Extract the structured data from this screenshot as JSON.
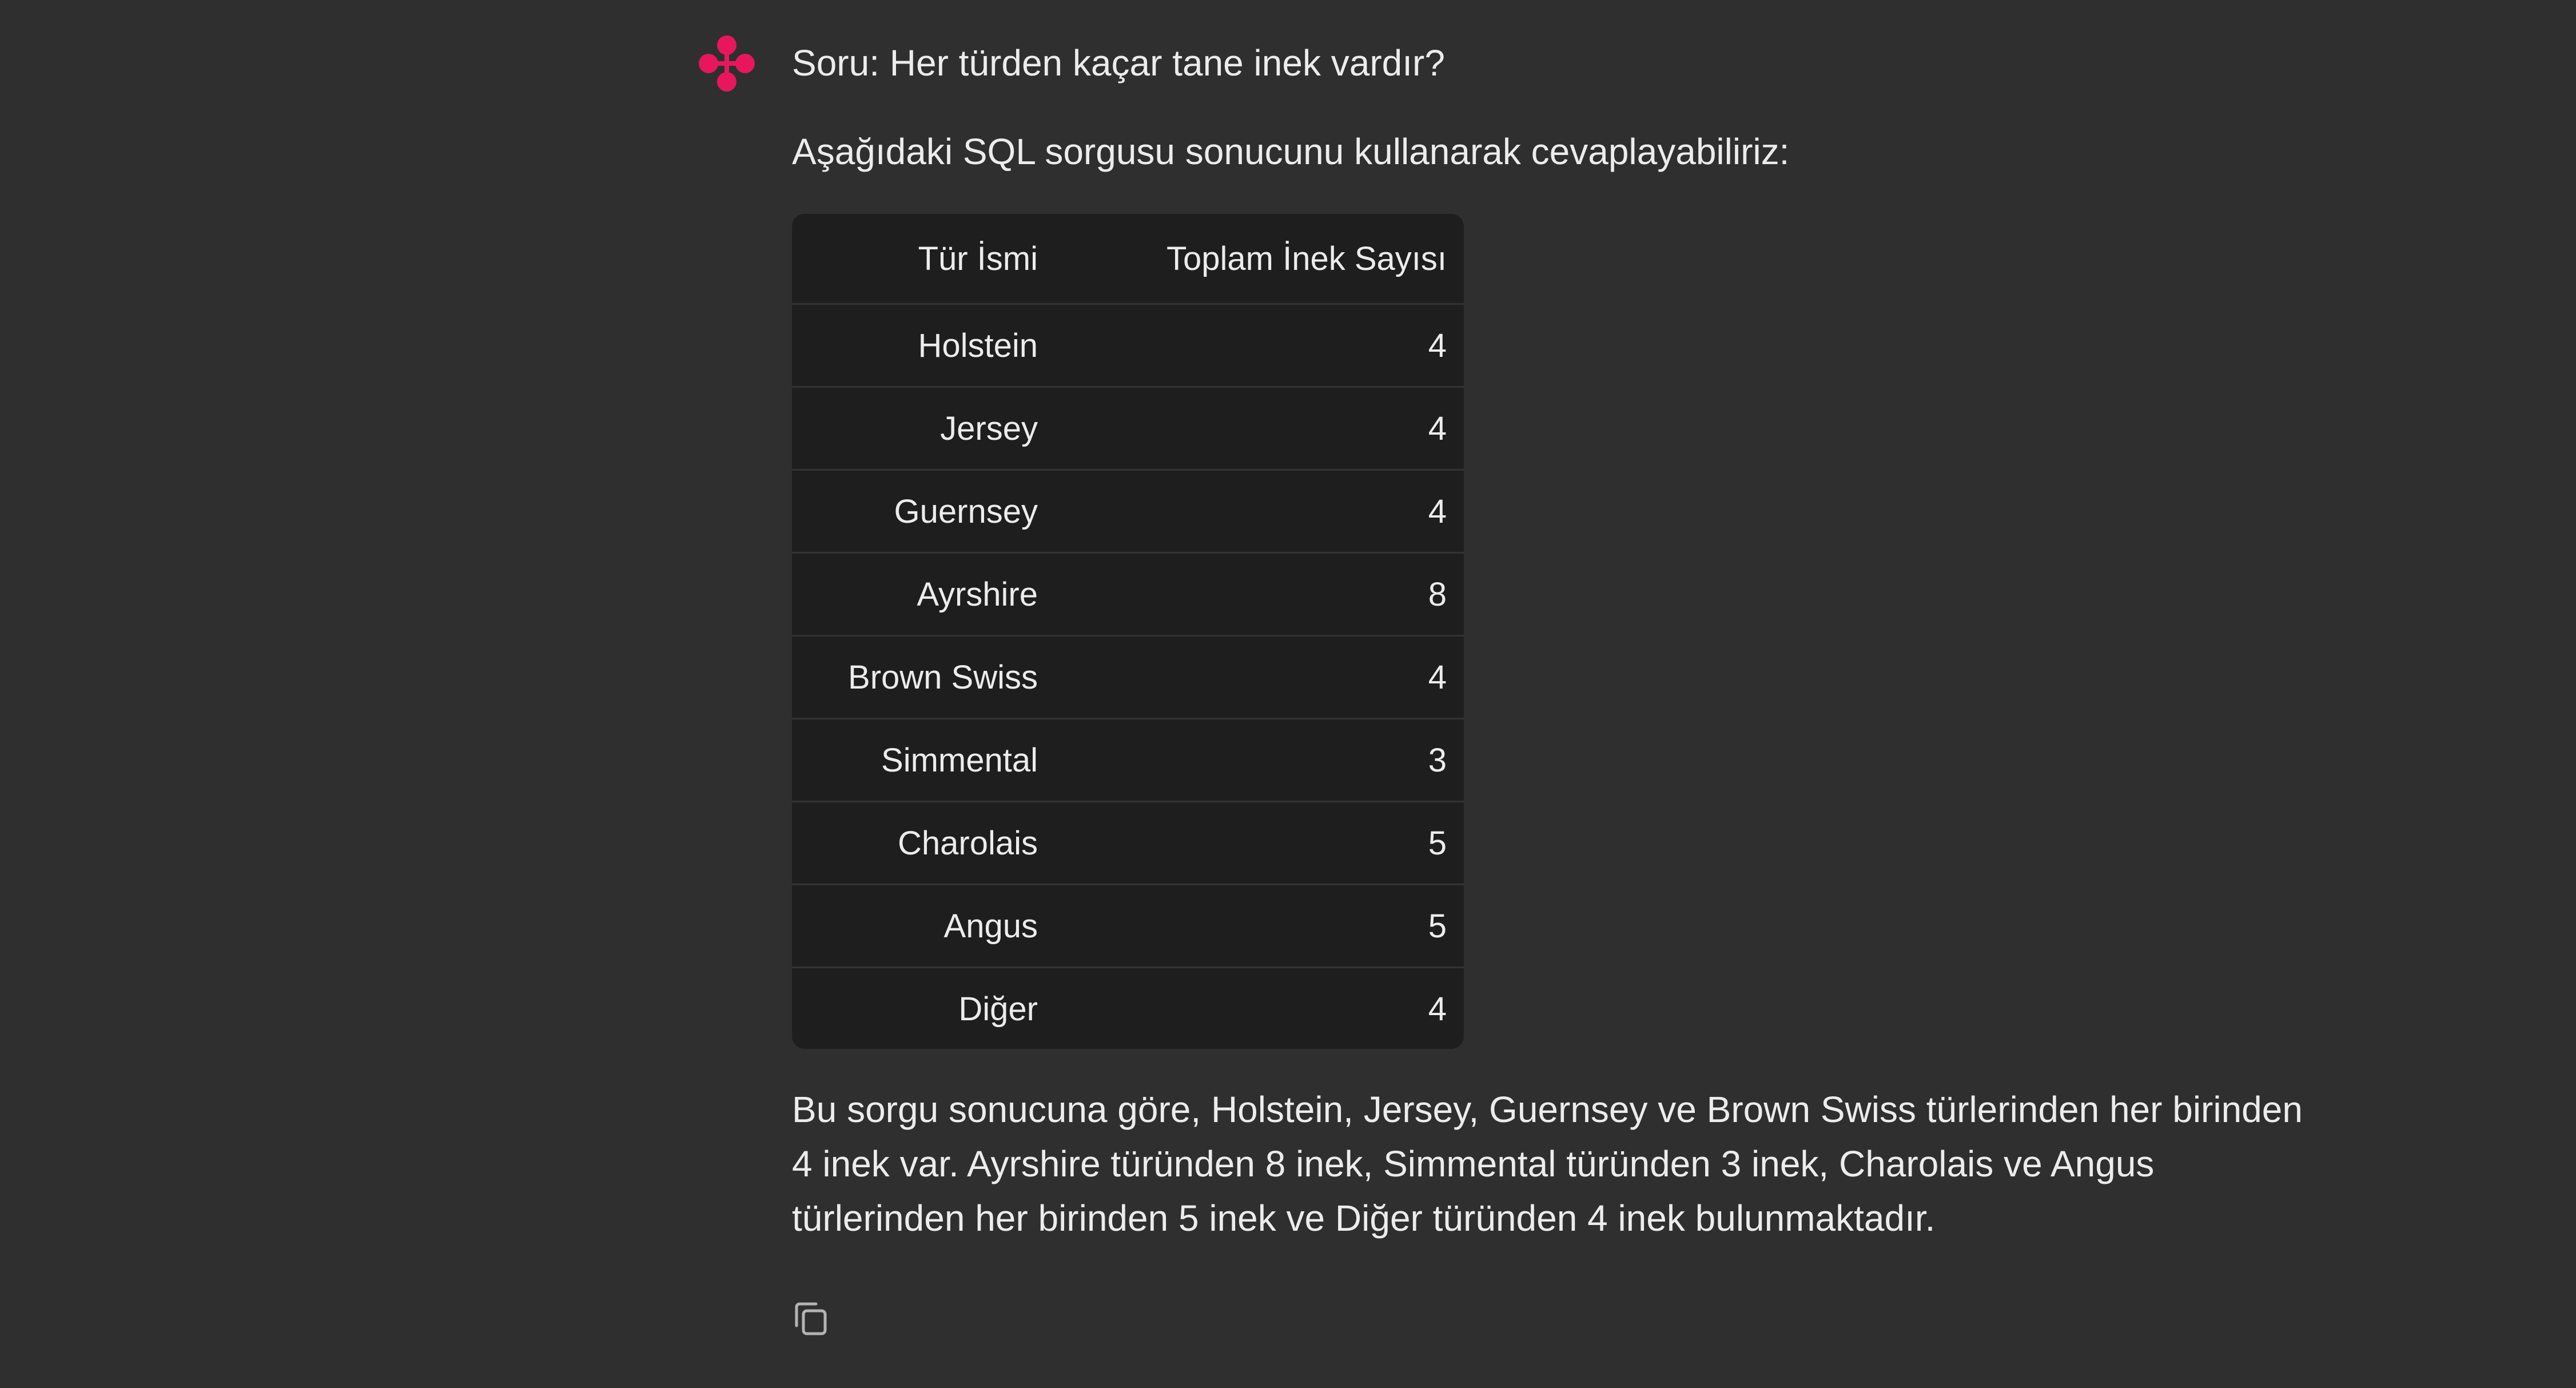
{
  "message": {
    "question": "Soru: Her türden kaçar tane inek vardır?",
    "intro": "Aşağıdaki SQL sorgusu sonucunu kullanarak cevaplayabiliriz:",
    "table": {
      "headers": [
        "Tür İsmi",
        "Toplam İnek Sayısı"
      ],
      "rows": [
        [
          "Holstein",
          "4"
        ],
        [
          "Jersey",
          "4"
        ],
        [
          "Guernsey",
          "4"
        ],
        [
          "Ayrshire",
          "8"
        ],
        [
          "Brown Swiss",
          "4"
        ],
        [
          "Simmental",
          "3"
        ],
        [
          "Charolais",
          "5"
        ],
        [
          "Angus",
          "5"
        ],
        [
          "Diğer",
          "4"
        ]
      ]
    },
    "summary": "Bu sorgu sonucuna göre, Holstein, Jersey, Guernsey ve Brown Swiss türlerinden her birinden 4 inek var. Ayrshire türünden 8 inek, Simmental türünden 3 inek, Charolais ve Angus türlerinden her birinden 5 inek ve Diğer türünden 4 inek bulunmaktadır."
  },
  "icons": {
    "logo": "assistant-logo-icon",
    "copy": "copy-icon"
  },
  "colors": {
    "background": "#2f2f2f",
    "table_background": "#1e1e1e",
    "text": "#ececec",
    "logo": "#e8175d"
  }
}
